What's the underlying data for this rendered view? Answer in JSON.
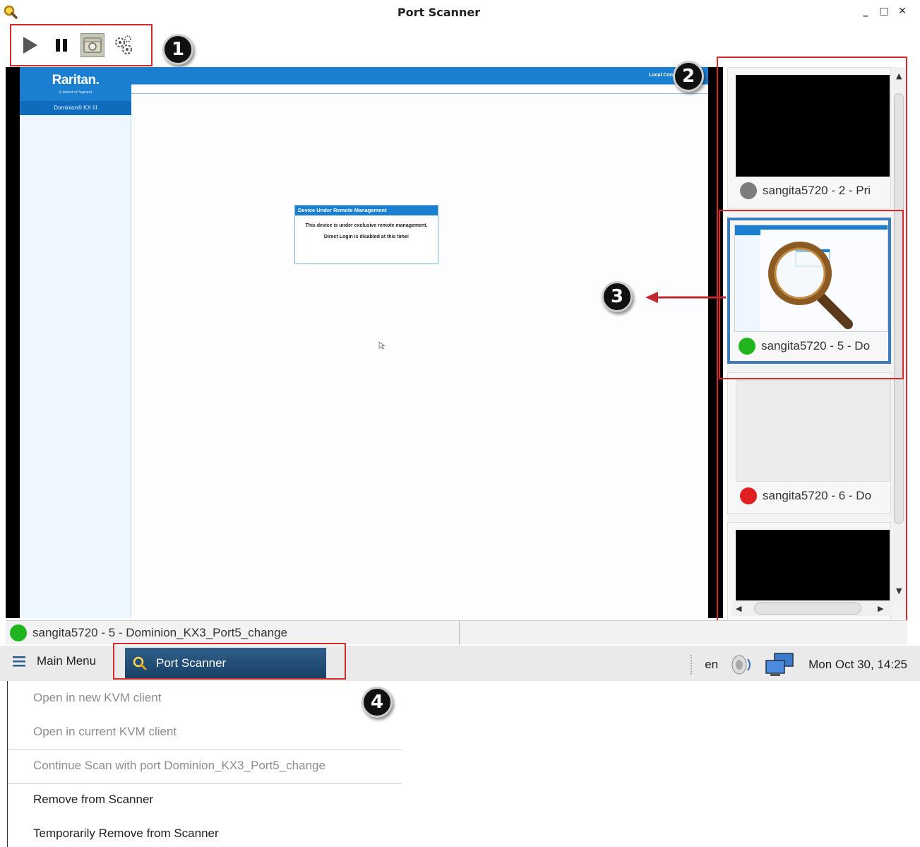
{
  "window": {
    "title": "Port Scanner",
    "controls": [
      "_",
      "□",
      "✕"
    ]
  },
  "toolbar": {
    "buttons": [
      {
        "name": "play-icon",
        "active": false
      },
      {
        "name": "pause-icon",
        "active": false
      },
      {
        "name": "screenshot-icon",
        "active": true
      },
      {
        "name": "settings-icon",
        "active": false
      }
    ]
  },
  "callouts": [
    "1",
    "2",
    "3",
    "4"
  ],
  "kvm": {
    "brand": "Raritan.",
    "brand_sub": "A brand of legrand",
    "product": "Dominion® KX III",
    "local": "Local Con",
    "dialog": {
      "title": "Device Under Remote Management",
      "line1": "This device is under exclusive remote management.",
      "line2": "Direct Login is disabled at this time!"
    }
  },
  "thumbnails": [
    {
      "label": "sangita5720 - 2 - Pri",
      "status": "offline",
      "screen": "black"
    },
    {
      "label": "sangita5720 - 5 - Do",
      "status": "online",
      "screen": "kvm",
      "selected": true
    },
    {
      "label": "sangita5720 - 6 - Do",
      "status": "error",
      "screen": "blank"
    },
    {
      "label": "",
      "status": "",
      "screen": "black"
    }
  ],
  "status_colors": {
    "offline": "#7d7d7d",
    "online": "#22b520",
    "error": "#e02020"
  },
  "statusbar": {
    "text": "sangita5720 - 5 - Dominion_KX3_Port5_change",
    "status": "online"
  },
  "taskbar": {
    "main_menu": "Main Menu",
    "task": "Port Scanner",
    "lang": "en",
    "clock": "Mon Oct 30, 14:25"
  },
  "context_menu": {
    "items": [
      {
        "label": "Open in new KVM client",
        "enabled": false
      },
      {
        "label": "Open in current KVM client",
        "enabled": false
      },
      {
        "label": "Continue Scan with port Dominion_KX3_Port5_change",
        "enabled": false
      },
      {
        "label": "Remove from Scanner",
        "enabled": true
      },
      {
        "label": "Temporarily Remove from Scanner",
        "enabled": true
      }
    ]
  }
}
